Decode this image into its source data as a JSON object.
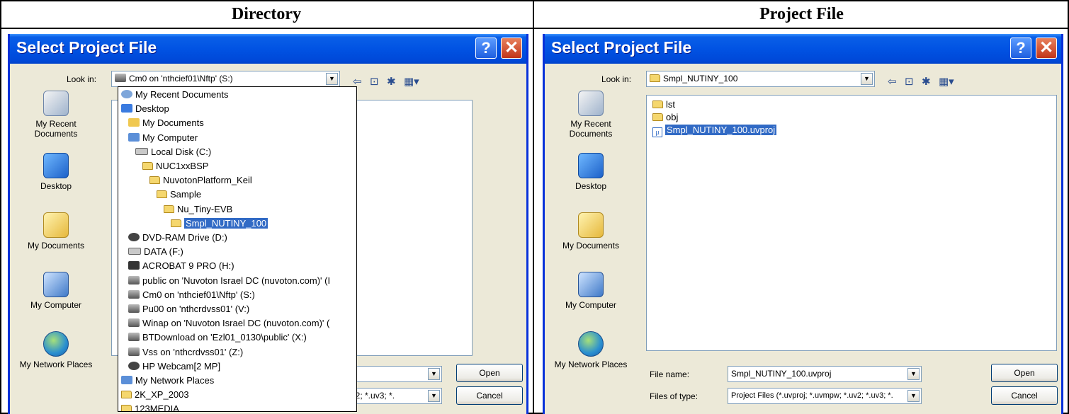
{
  "headers": {
    "left": "Directory",
    "right": "Project File"
  },
  "dialog": {
    "title": "Select Project File",
    "help_glyph": "?",
    "close_glyph": "✕",
    "look_in_label": "Look in:",
    "file_name_label": "File name:",
    "files_of_type_label": "Files of type:",
    "open_button": "Open",
    "cancel_button": "Cancel",
    "toolbar": {
      "back": "⇦",
      "up": "⊡",
      "new_folder": "✱",
      "views": "▦▾"
    }
  },
  "places": {
    "recent": "My Recent Documents",
    "desktop": "Desktop",
    "documents": "My Documents",
    "computer": "My Computer",
    "network": "My Network Places"
  },
  "left": {
    "look_in_value": "Cm0 on 'nthcief01\\Nftp' (S:)",
    "type_partial": "uv2; *.uv3; *.",
    "dropdown": [
      {
        "label": "My Recent Documents",
        "icon": "recent-icon"
      },
      {
        "label": "Desktop",
        "icon": "desktop-icon"
      },
      {
        "label": "My Documents",
        "icon": "documents-icon"
      },
      {
        "label": "My Computer",
        "icon": "computer-icon"
      },
      {
        "label": "Local Disk (C:)",
        "icon": "drive-icon"
      },
      {
        "label": "NUC1xxBSP",
        "icon": "folder-icon"
      },
      {
        "label": "NuvotonPlatform_Keil",
        "icon": "folder-icon"
      },
      {
        "label": "Sample",
        "icon": "folder-icon"
      },
      {
        "label": "Nu_Tiny-EVB",
        "icon": "folder-icon"
      },
      {
        "label": "Smpl_NUTINY_100",
        "icon": "folder-icon"
      },
      {
        "label": "DVD-RAM Drive (D:)",
        "icon": "dvd-icon"
      },
      {
        "label": "DATA (F:)",
        "icon": "drive-icon"
      },
      {
        "label": "ACROBAT 9 PRO (H:)",
        "icon": "adobe-icon"
      },
      {
        "label": "public on 'Nuvoton Israel DC (nuvoton.com)' (I",
        "icon": "network-drive-icon"
      },
      {
        "label": "Cm0 on 'nthcief01\\Nftp' (S:)",
        "icon": "network-drive-icon"
      },
      {
        "label": "Pu00 on 'nthcrdvss01' (V:)",
        "icon": "network-drive-icon"
      },
      {
        "label": "Winap on 'Nuvoton Israel DC (nuvoton.com)' (",
        "icon": "network-drive-icon"
      },
      {
        "label": "BTDownload on 'Ezl01_0130\\public' (X:)",
        "icon": "network-drive-icon"
      },
      {
        "label": "Vss on 'nthcrdvss01' (Z:)",
        "icon": "network-drive-icon"
      },
      {
        "label": "HP Webcam[2 MP]",
        "icon": "webcam-icon"
      },
      {
        "label": "My Network Places",
        "icon": "network-icon"
      },
      {
        "label": "2K_XP_2003",
        "icon": "folder-icon"
      },
      {
        "label": "123MEDIA",
        "icon": "folder-icon"
      }
    ]
  },
  "right": {
    "look_in_value": "Smpl_NUTINY_100",
    "files": [
      {
        "name": "lst",
        "type": "folder"
      },
      {
        "name": "obj",
        "type": "folder"
      },
      {
        "name": "Smpl_NUTINY_100.uvproj",
        "type": "project"
      }
    ],
    "file_name_value": "Smpl_NUTINY_100.uvproj",
    "files_of_type_value": "Project Files (*.uvproj; *.uvmpw; *.uv2; *.uv3; *."
  }
}
